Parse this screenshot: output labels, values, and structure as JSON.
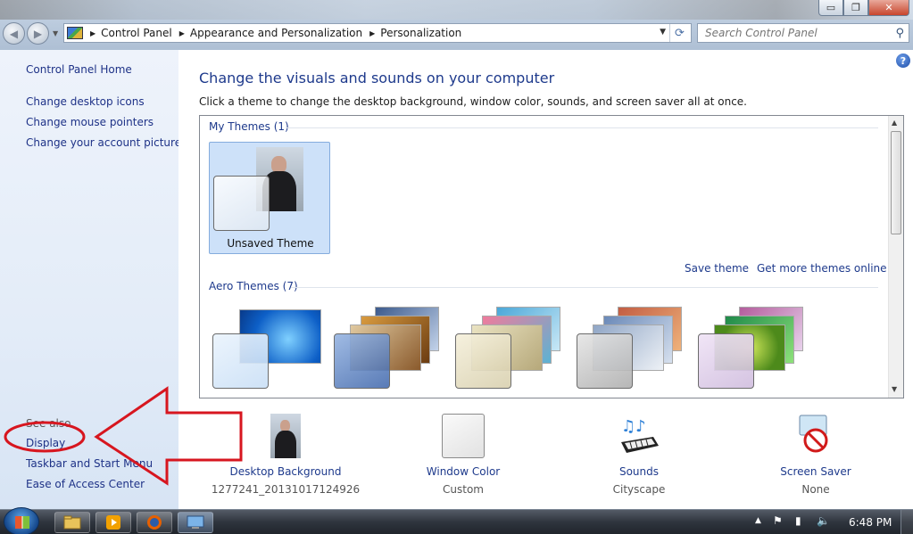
{
  "window": {
    "controls": {
      "minimize": "▭",
      "maximize": "❐",
      "close": "✕"
    }
  },
  "navigation": {
    "back_icon": "back-arrow-icon",
    "forward_icon": "forward-arrow-icon",
    "breadcrumbs": [
      "Control Panel",
      "Appearance and Personalization",
      "Personalization"
    ],
    "search_placeholder": "Search Control Panel"
  },
  "sidebar": {
    "home": "Control Panel Home",
    "links": [
      "Change desktop icons",
      "Change mouse pointers",
      "Change your account picture"
    ],
    "see_also": "See also",
    "see_also_links": [
      "Display",
      "Taskbar and Start Menu",
      "Ease of Access Center"
    ]
  },
  "main": {
    "heading": "Change the visuals and sounds on your computer",
    "subtext": "Click a theme to change the desktop background, window color, sounds, and screen saver all at once.",
    "my_themes_label": "My Themes (1)",
    "selected_theme_name": "Unsaved Theme",
    "save_theme": "Save theme",
    "get_more_themes": "Get more themes online",
    "aero_themes_label": "Aero Themes (7)"
  },
  "bottom_items": [
    {
      "label": "Desktop Background",
      "sub": "1277241_20131017124926",
      "icon": "desktop-background-icon"
    },
    {
      "label": "Window Color",
      "sub": "Custom",
      "icon": "window-color-icon"
    },
    {
      "label": "Sounds",
      "sub": "Cityscape",
      "icon": "sounds-icon"
    },
    {
      "label": "Screen Saver",
      "sub": "None",
      "icon": "screen-saver-icon"
    }
  ],
  "taskbar": {
    "clock": "6:48 PM",
    "apps": [
      "explorer-icon",
      "media-player-icon",
      "firefox-icon",
      "control-panel-icon"
    ]
  },
  "colors": {
    "link": "#1e3a8c",
    "sidebar_link": "#1e3287",
    "selection": "#cde1f9",
    "annotation": "#d7161f"
  }
}
